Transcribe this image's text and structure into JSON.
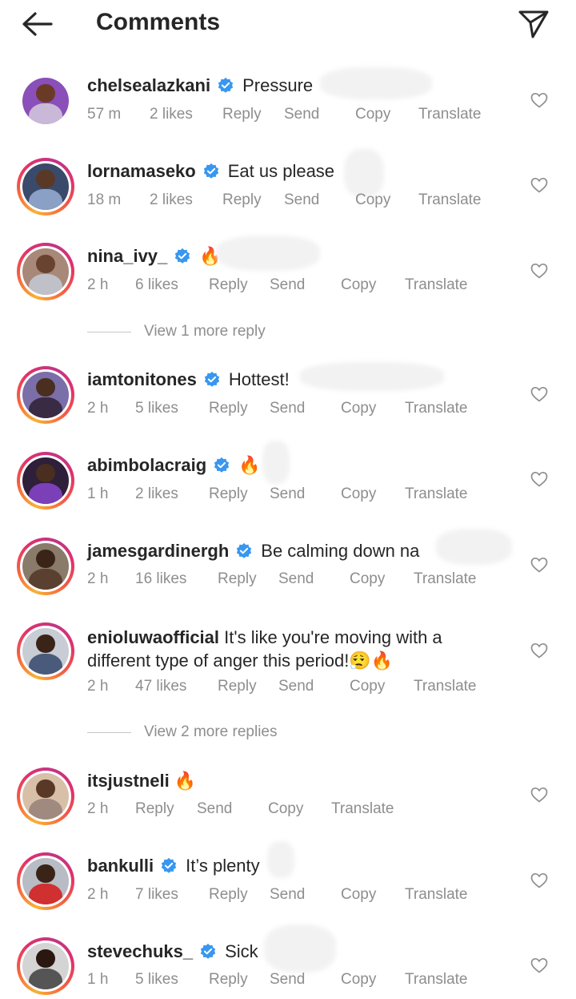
{
  "header": {
    "title": "Comments",
    "back_icon": "back-arrow-icon",
    "send_icon": "paper-plane-icon"
  },
  "actions": {
    "reply": "Reply",
    "send": "Send",
    "copy": "Copy",
    "translate": "Translate"
  },
  "comments": [
    {
      "username": "chelsealazkani",
      "verified": true,
      "text": "Pressure",
      "time": "57 m",
      "likes": "2 likes"
    },
    {
      "username": "lornamaseko",
      "verified": true,
      "text": "Eat us please",
      "time": "18 m",
      "likes": "2 likes"
    },
    {
      "username": "nina_ivy_",
      "verified": true,
      "text": "🔥",
      "time": "2 h",
      "likes": "6 likes",
      "view_more": "View 1 more reply"
    },
    {
      "username": "iamtonitones",
      "verified": true,
      "text": "Hottest!",
      "time": "2 h",
      "likes": "5 likes"
    },
    {
      "username": "abimbolacraig",
      "verified": true,
      "text": "🔥",
      "time": "1 h",
      "likes": "2 likes"
    },
    {
      "username": "jamesgardinergh",
      "verified": true,
      "text": "Be calming down na",
      "time": "2 h",
      "likes": "16 likes"
    },
    {
      "username": "enioluwaofficial",
      "verified": false,
      "text": "It's like you're moving with a",
      "text2": "different type of anger this period!😮‍💨🔥",
      "time": "2 h",
      "likes": "47 likes",
      "view_more": "View 2 more replies"
    },
    {
      "username": "itsjustneli",
      "verified": false,
      "text": "🔥",
      "time": "2 h",
      "likes": ""
    },
    {
      "username": "bankulli",
      "verified": true,
      "text": "It’s plenty",
      "time": "2 h",
      "likes": "7 likes"
    },
    {
      "username": "stevechuks_",
      "verified": true,
      "text": "Sick",
      "time": "1 h",
      "likes": "5 likes"
    }
  ],
  "colors": {
    "text": "#262626",
    "secondary": "#8e8e8e",
    "verified_blue": "#3897f0",
    "story_ring": "#e1306c"
  },
  "icons": {
    "verified": "verified-badge-icon",
    "like": "heart-icon"
  }
}
